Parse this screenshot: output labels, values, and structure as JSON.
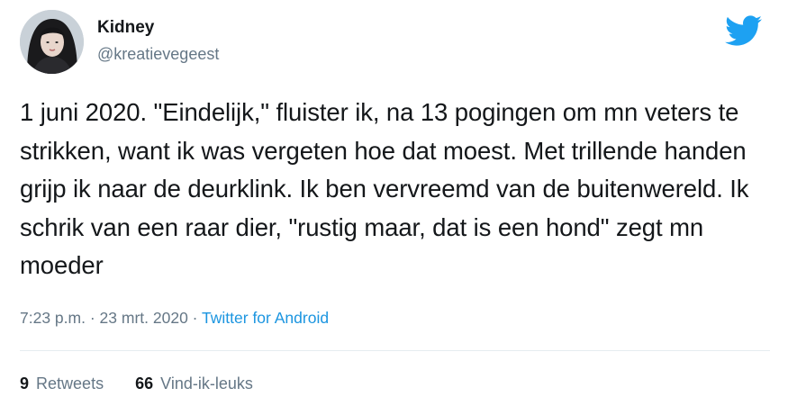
{
  "author": {
    "display_name": "Kidney",
    "handle": "@kreatievegeest",
    "avatar_icon": "profile-photo"
  },
  "brand": {
    "icon": "twitter-bird-icon",
    "color": "#1da1f2"
  },
  "tweet": {
    "text": "1 juni 2020. \"Eindelijk,\" fluister ik, na 13 pogingen om mn veters te strikken, want ik was vergeten hoe dat moest. Met trillende handen grijp ik naar de deurklink. Ik ben vervreemd van de buitenwereld. Ik schrik van een raar dier, \"rustig maar, dat is een hond\" zegt mn moeder"
  },
  "meta": {
    "time": "7:23 p.m.",
    "separator": "·",
    "date": "23 mrt. 2020",
    "source": "Twitter for Android",
    "source_color": "#1b95e0"
  },
  "stats": {
    "retweets_count": "9",
    "retweets_label": "Retweets",
    "likes_count": "66",
    "likes_label": "Vind-ik-leuks"
  }
}
